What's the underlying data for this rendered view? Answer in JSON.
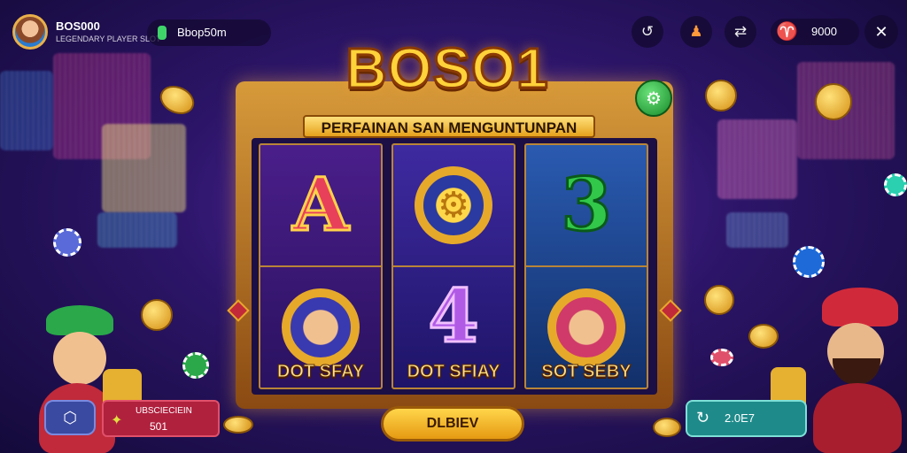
{
  "player": {
    "name": "BOS000",
    "subtitle": "LEGENDARY PLAYER SLOT"
  },
  "balance": {
    "value": "Bbop50m"
  },
  "top_icons": {
    "history": "↺",
    "profile": "♟",
    "swap": "⇄",
    "coin_icon": "♈",
    "close": "✕"
  },
  "coins": {
    "value": "9000"
  },
  "game": {
    "title": "BOSO1",
    "subtitle": "PERFAINAN SAN MENGUNTUNPAN"
  },
  "reels": [
    {
      "top_symbol": "A",
      "top_color": "#e8405a",
      "bottom_caption": "DOT SFAY"
    },
    {
      "top_symbol": "⚙",
      "top_color": "#e6a92a",
      "bottom_symbol": "4",
      "bottom_color": "#b05ae6",
      "bottom_caption": "DOT SFIAY"
    },
    {
      "top_symbol": "3",
      "top_color": "#32c84a",
      "bottom_caption": "SOT SEBY"
    }
  ],
  "side_button": "⚙",
  "controls": {
    "spin_label": "DLBIEV",
    "left_icon": "⬡",
    "left_panel_title": "UBSCIECIEIN",
    "left_panel_value": "501",
    "left_panel_icon": "✦",
    "right_icon": "↻",
    "right_value": "2.0E7"
  }
}
